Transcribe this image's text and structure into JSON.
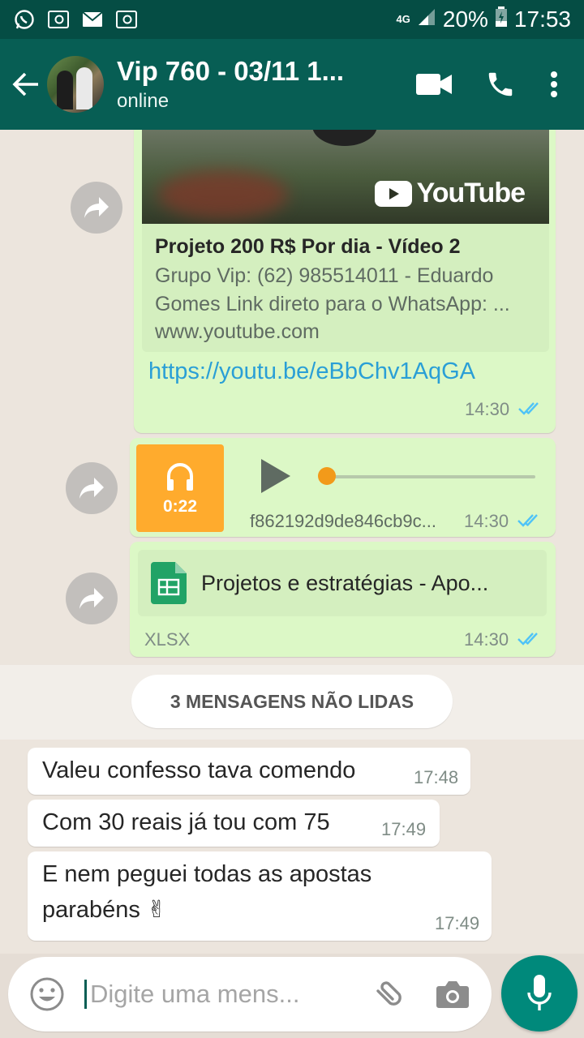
{
  "status_bar": {
    "network": "4G",
    "battery": "20%",
    "time": "17:53"
  },
  "header": {
    "title": "Vip 760 - 03/11 1...",
    "subtitle": "online"
  },
  "messages": {
    "youtube": {
      "title": "Projeto 200 R$ Por dia - Vídeo 2",
      "description": "Grupo Vip: (62) 985514011 - Eduardo Gomes Link direto para o WhatsApp: ...",
      "domain": "www.youtube.com",
      "logo_text": "YouTube",
      "url": "https://youtu.be/eBbChv1AqGA",
      "time": "14:30"
    },
    "audio": {
      "duration": "0:22",
      "filename": "f862192d9de846cb9c...",
      "time": "14:30"
    },
    "document": {
      "name": "Projetos e estratégias - Apo...",
      "type": "XLSX",
      "time": "14:30"
    },
    "unread_label": "3 MENSAGENS NÃO LIDAS",
    "incoming": [
      {
        "text": "Valeu confesso tava comendo",
        "time": "17:48"
      },
      {
        "text": "Com 30 reais já tou com 75",
        "time": "17:49"
      },
      {
        "text_line1": "E nem peguei todas as apostas",
        "text_line2": "parabéns ✌",
        "time": "17:49"
      }
    ]
  },
  "input": {
    "placeholder": "Digite uma mens..."
  },
  "colors": {
    "header": "#075e54",
    "status_bar": "#054d44",
    "outgoing_bubble": "#dcf8c6",
    "accent": "#00897b",
    "link": "#2a9fd6",
    "audio_tile": "#ffab2d"
  }
}
